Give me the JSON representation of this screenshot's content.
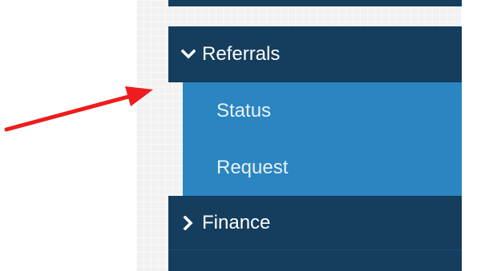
{
  "sidebar": {
    "items": [
      {
        "label": "Referrals",
        "state": "expanded",
        "icon": "chevron-down-icon"
      },
      {
        "label": "Finance",
        "state": "collapsed",
        "icon": "chevron-right-icon"
      }
    ],
    "referrals_submenu": [
      {
        "label": "Status"
      },
      {
        "label": "Request"
      }
    ]
  },
  "colors": {
    "nav_dark": "#143d5e",
    "submenu_blue": "#2a85c0",
    "arrow_red": "#ee1c1c"
  }
}
